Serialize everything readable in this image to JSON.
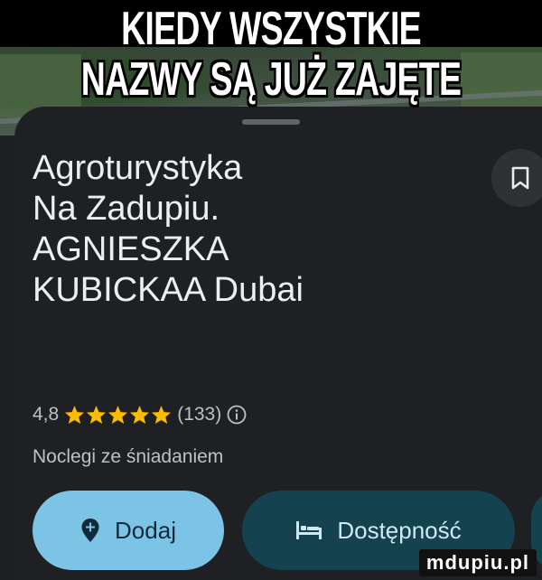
{
  "meme": {
    "line1": "KIEDY WSZYSTKIE",
    "line2": "NAZWY SĄ JUŻ ZAJĘTE"
  },
  "place": {
    "name_lines": [
      "Agroturystyka",
      "Na Zadupiu.",
      "AGNIESZKA",
      "KUBICKAA Dubai"
    ],
    "rating": "4,8",
    "stars": 5,
    "reviews": "(133)",
    "category": "Noclegi ze śniadaniem"
  },
  "icons": {
    "save": "bookmark-icon",
    "info": "info-icon",
    "add": "location-pin-plus-icon",
    "availability": "bed-icon"
  },
  "actions": {
    "add_label": "Dodaj",
    "availability_label": "Dostępność"
  },
  "watermark": "mdupiu.pl",
  "colors": {
    "sheet_bg": "#1f2023",
    "star": "#fbbc04",
    "add_button": "#7cc4e6",
    "availability_button": "#14424e"
  }
}
